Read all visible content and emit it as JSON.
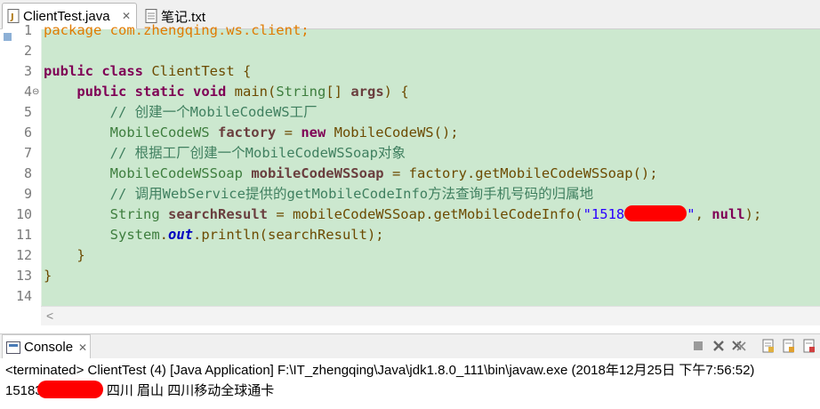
{
  "tabs": [
    {
      "label": "ClientTest.java",
      "icon": "java-file-icon",
      "active": true
    },
    {
      "label": "笔记.txt",
      "icon": "text-file-icon",
      "active": false
    }
  ],
  "editor": {
    "highlight_color": "#cce8cf",
    "lines": [
      {
        "num": "1",
        "tokens": [
          {
            "t": "package",
            "c": "kw-orange"
          },
          {
            "t": " com.zhengqing.ws.client;",
            "c": "kw-orange"
          }
        ]
      },
      {
        "num": "2",
        "tokens": []
      },
      {
        "num": "3",
        "tokens": [
          {
            "t": "public",
            "c": "kw"
          },
          {
            "t": " ",
            "c": ""
          },
          {
            "t": "class",
            "c": "kw"
          },
          {
            "t": " ClientTest {",
            "c": "plain"
          }
        ]
      },
      {
        "num": "4",
        "tokens": [
          {
            "t": "    ",
            "c": ""
          },
          {
            "t": "public",
            "c": "kw"
          },
          {
            "t": " ",
            "c": ""
          },
          {
            "t": "static",
            "c": "kw"
          },
          {
            "t": " ",
            "c": ""
          },
          {
            "t": "void",
            "c": "kw"
          },
          {
            "t": " main(",
            "c": "plain"
          },
          {
            "t": "String",
            "c": "type"
          },
          {
            "t": "[] ",
            "c": "plain"
          },
          {
            "t": "args",
            "c": "var"
          },
          {
            "t": ") {",
            "c": "plain"
          }
        ]
      },
      {
        "num": "5",
        "tokens": [
          {
            "t": "        // 创建一个MobileCodeWS工厂",
            "c": "cmt"
          }
        ]
      },
      {
        "num": "6",
        "tokens": [
          {
            "t": "        ",
            "c": ""
          },
          {
            "t": "MobileCodeWS",
            "c": "type"
          },
          {
            "t": " ",
            "c": ""
          },
          {
            "t": "factory",
            "c": "var"
          },
          {
            "t": " = ",
            "c": "plain"
          },
          {
            "t": "new",
            "c": "kw"
          },
          {
            "t": " MobileCodeWS();",
            "c": "plain"
          }
        ]
      },
      {
        "num": "7",
        "tokens": [
          {
            "t": "        // 根据工厂创建一个MobileCodeWSSoap对象",
            "c": "cmt"
          }
        ]
      },
      {
        "num": "8",
        "tokens": [
          {
            "t": "        ",
            "c": ""
          },
          {
            "t": "MobileCodeWSSoap",
            "c": "type"
          },
          {
            "t": " ",
            "c": ""
          },
          {
            "t": "mobileCodeWSSoap",
            "c": "var"
          },
          {
            "t": " = factory.getMobileCodeWSSoap();",
            "c": "plain"
          }
        ]
      },
      {
        "num": "9",
        "tokens": [
          {
            "t": "        // 调用WebService提供的getMobileCodeInfo方法查询手机号码的归属地",
            "c": "cmt"
          }
        ]
      },
      {
        "num": "10",
        "tokens": [
          {
            "t": "        ",
            "c": ""
          },
          {
            "t": "String",
            "c": "type"
          },
          {
            "t": " ",
            "c": ""
          },
          {
            "t": "searchResult",
            "c": "var"
          },
          {
            "t": " = mobileCodeWSSoap.getMobileCodeInfo(",
            "c": "plain"
          },
          {
            "t": "\"1518",
            "c": "str"
          },
          {
            "t": "",
            "c": "redact"
          },
          {
            "t": "\"",
            "c": "str"
          },
          {
            "t": ", ",
            "c": "plain"
          },
          {
            "t": "null",
            "c": "kw"
          },
          {
            "t": ");",
            "c": "plain"
          }
        ]
      },
      {
        "num": "11",
        "tokens": [
          {
            "t": "        ",
            "c": ""
          },
          {
            "t": "System",
            "c": "type"
          },
          {
            "t": ".",
            "c": "plain"
          },
          {
            "t": "out",
            "c": "field"
          },
          {
            "t": ".println(searchResult);",
            "c": "plain"
          }
        ]
      },
      {
        "num": "12",
        "tokens": [
          {
            "t": "    }",
            "c": "plain"
          }
        ]
      },
      {
        "num": "13",
        "tokens": [
          {
            "t": "}",
            "c": "plain"
          }
        ]
      },
      {
        "num": "14",
        "tokens": []
      }
    ]
  },
  "console": {
    "tab_label": "Console",
    "status": "<terminated> ClientTest (4) [Java Application] F:\\IT_zhengqing\\Java\\jdk1.8.0_111\\bin\\javaw.exe (2018年12月25日 下午7:56:52)",
    "output_prefix": "15183",
    "output_suffix": " 四川 眉山 四川移动全球通卡",
    "toolbar": [
      "stop-icon",
      "remove-launch-icon",
      "remove-all-icon",
      "scroll-lock-icon",
      "show-when-stdout-icon",
      "show-when-stderr-icon"
    ]
  }
}
